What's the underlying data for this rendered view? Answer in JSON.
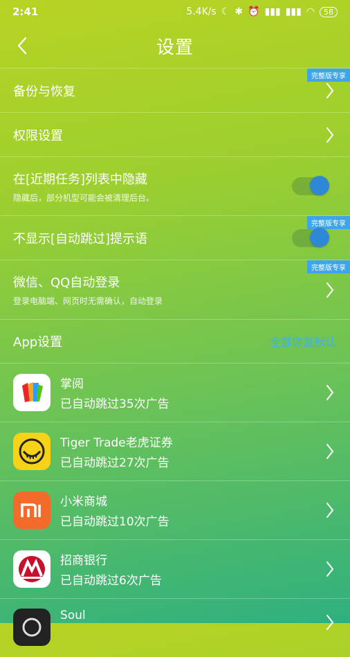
{
  "status": {
    "time": "2:41",
    "net_speed": "5.4K/s",
    "battery": "58"
  },
  "header": {
    "title": "设置"
  },
  "badge_label": "完整版专享",
  "settings": {
    "backup": "备份与恢复",
    "permissions": "权限设置",
    "hide_recent": {
      "label": "在[近期任务]列表中隐藏",
      "desc": "隐藏后，部分机型可能会被清理后台。",
      "on": true
    },
    "hide_tip": {
      "label": "不显示[自动跳过]提示语",
      "on": true
    },
    "auto_login": {
      "label": "微信、QQ自动登录",
      "desc": "登录电脑端、网页时无需确认，自动登录"
    }
  },
  "app_section": {
    "title": "App设置",
    "restore_all": "全部恢复默认"
  },
  "apps": [
    {
      "name": "掌阅",
      "count": "已自动跳过35次广告",
      "icon": "zhangyue-icon"
    },
    {
      "name": "Tiger Trade老虎证券",
      "count": "已自动跳过27次广告",
      "icon": "tiger-icon"
    },
    {
      "name": "小米商城",
      "count": "已自动跳过10次广告",
      "icon": "mi-icon"
    },
    {
      "name": "招商银行",
      "count": "已自动跳过6次广告",
      "icon": "cmb-icon"
    },
    {
      "name": "Soul",
      "count": "",
      "icon": "soul-icon"
    }
  ],
  "colors": {
    "accent": "#3ea6e8",
    "toggle_knob": "#2f88d6",
    "mi_orange": "#f26b2b",
    "cmb_red": "#c8102e",
    "tiger_yellow": "#f7d216"
  }
}
